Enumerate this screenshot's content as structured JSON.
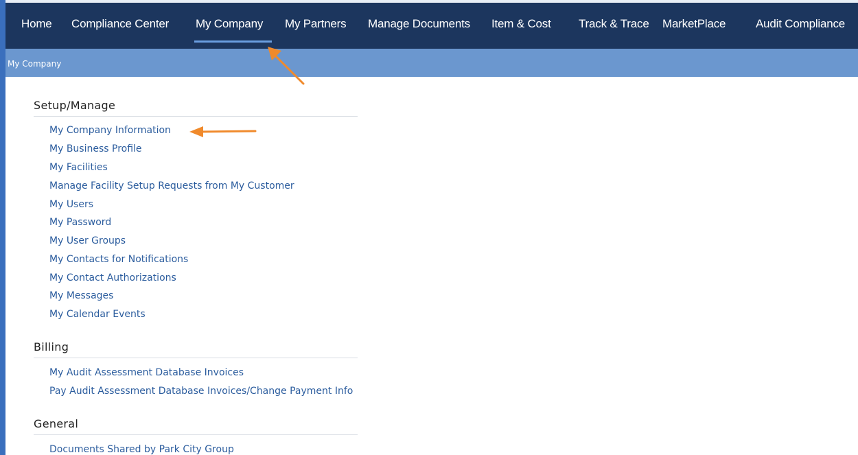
{
  "nav": {
    "items": [
      {
        "label": "Home"
      },
      {
        "label": "Compliance Center"
      },
      {
        "label": "My Company"
      },
      {
        "label": "My Partners"
      },
      {
        "label": "Manage Documents"
      },
      {
        "label": "Item & Cost"
      },
      {
        "label": "Track & Trace"
      },
      {
        "label": "MarketPlace"
      },
      {
        "label": "Audit Compliance"
      }
    ],
    "active": "My Company",
    "bg_color": "#1c365e",
    "underline_color": "#6a9ee0"
  },
  "breadcrumb": {
    "label": "My Company",
    "bg_color": "#6b97cf"
  },
  "sections": [
    {
      "title": "Setup/Manage",
      "links": [
        "My Company Information",
        "My Business Profile",
        "My Facilities",
        "Manage Facility Setup Requests from My Customer",
        "My Users",
        "My Password",
        "My User Groups",
        "My Contacts for Notifications",
        "My Contact Authorizations",
        "My Messages",
        "My Calendar Events"
      ]
    },
    {
      "title": "Billing",
      "links": [
        "My Audit Assessment Database Invoices",
        "Pay Audit Assessment Database Invoices/Change Payment Info"
      ]
    },
    {
      "title": "General",
      "links": [
        "Documents Shared by Park City Group"
      ]
    }
  ],
  "link_color": "#2c5d9e",
  "annotation_arrow_color": "#f08a2c"
}
